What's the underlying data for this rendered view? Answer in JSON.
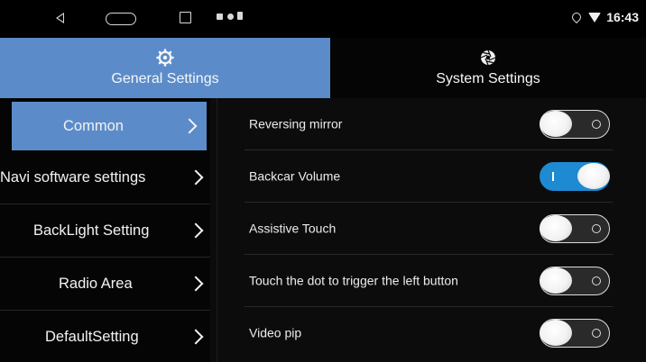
{
  "status_bar": {
    "time": "16:43",
    "icons": [
      "back-icon",
      "home-icon",
      "recent-apps-icon",
      "notification-icon",
      "record-icon",
      "battery-icon",
      "location-icon",
      "wifi-icon"
    ]
  },
  "tabs": [
    {
      "label": "General Settings",
      "icon": "gear-icon",
      "active": true
    },
    {
      "label": "System Settings",
      "icon": "aperture-icon",
      "active": false
    }
  ],
  "menu": {
    "items": [
      {
        "label": "Common",
        "active": true
      },
      {
        "label": "Navi software settings",
        "active": false
      },
      {
        "label": "BackLight Setting",
        "active": false
      },
      {
        "label": "Radio Area",
        "active": false
      },
      {
        "label": "DefaultSetting",
        "active": false
      }
    ]
  },
  "settings": [
    {
      "label": "Reversing mirror",
      "state": "off"
    },
    {
      "label": "Backcar Volume",
      "state": "on"
    },
    {
      "label": "Assistive Touch",
      "state": "off"
    },
    {
      "label": "Touch the dot to trigger the left button",
      "state": "off"
    },
    {
      "label": "Video pip",
      "state": "off"
    }
  ],
  "colors": {
    "accent": "#5b8cc9",
    "toggle_on": "#1e8ad1",
    "background": "#0c0c0c"
  }
}
